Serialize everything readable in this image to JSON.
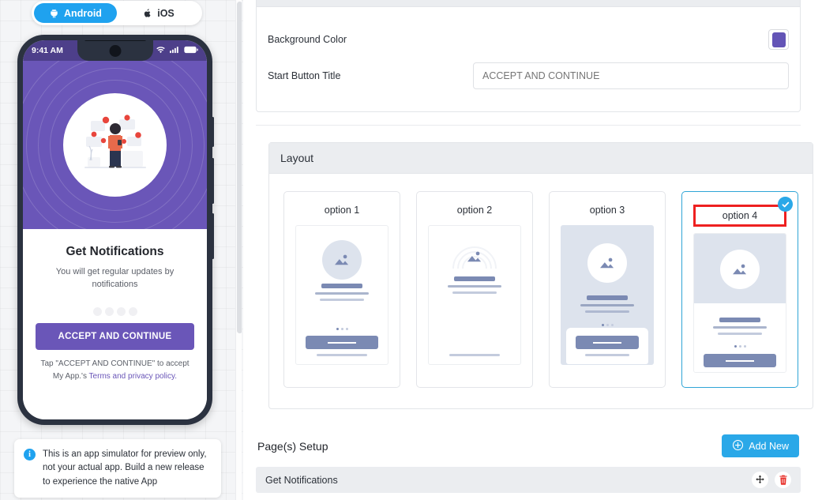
{
  "platform_tabs": [
    {
      "label": "Android",
      "icon": "android-icon",
      "active": true
    },
    {
      "label": "iOS",
      "icon": "apple-icon",
      "active": false
    }
  ],
  "phone_preview": {
    "status_bar": {
      "time": "9:41 AM",
      "icons": [
        "wifi-icon",
        "signal-icon",
        "battery-icon"
      ]
    },
    "heading": "Get Notifications",
    "subtitle": "You will get regular updates by notifications",
    "dots_count": 4,
    "start_button": "ACCEPT AND CONTINUE",
    "legal_prefix": "Tap \"ACCEPT AND CONTINUE\" to accept My App.'s ",
    "legal_link": "Terms and privacy policy.",
    "colors": {
      "primary": "#6a56b8",
      "status_bar": "#4d3f8a",
      "link": "#6a56b8"
    }
  },
  "info_note": {
    "icon": "info-icon",
    "text": "This is an app simulator for preview only, not your actual app. Build a new release to experience the native App"
  },
  "settings_card": {
    "rows": [
      {
        "label": "Background Color",
        "type": "color",
        "value": "#6354b6"
      },
      {
        "label": "Start Button Title",
        "type": "text",
        "value": "ACCEPT AND CONTINUE",
        "placeholder": "ACCEPT AND CONTINUE"
      }
    ]
  },
  "layout_card": {
    "title": "Layout",
    "selected_index": 3,
    "options": [
      {
        "label": "option 1",
        "style": "plain-top-cta"
      },
      {
        "label": "option 2",
        "style": "plain-no-cta"
      },
      {
        "label": "option 3",
        "style": "tinted-sheet-cta"
      },
      {
        "label": "option 4",
        "style": "tinted-split-cta"
      }
    ],
    "selected_badge_icon": "check-icon",
    "accent": "#30a5d6",
    "highlight": "#ee2020"
  },
  "pages_setup": {
    "title": "Page(s) Setup",
    "add_button": {
      "label": "Add New",
      "icon": "plus-circle-icon",
      "color": "#2aa8e8"
    },
    "rows": [
      {
        "label": "Get Notifications",
        "actions": [
          "move-icon",
          "delete-icon"
        ]
      }
    ]
  }
}
